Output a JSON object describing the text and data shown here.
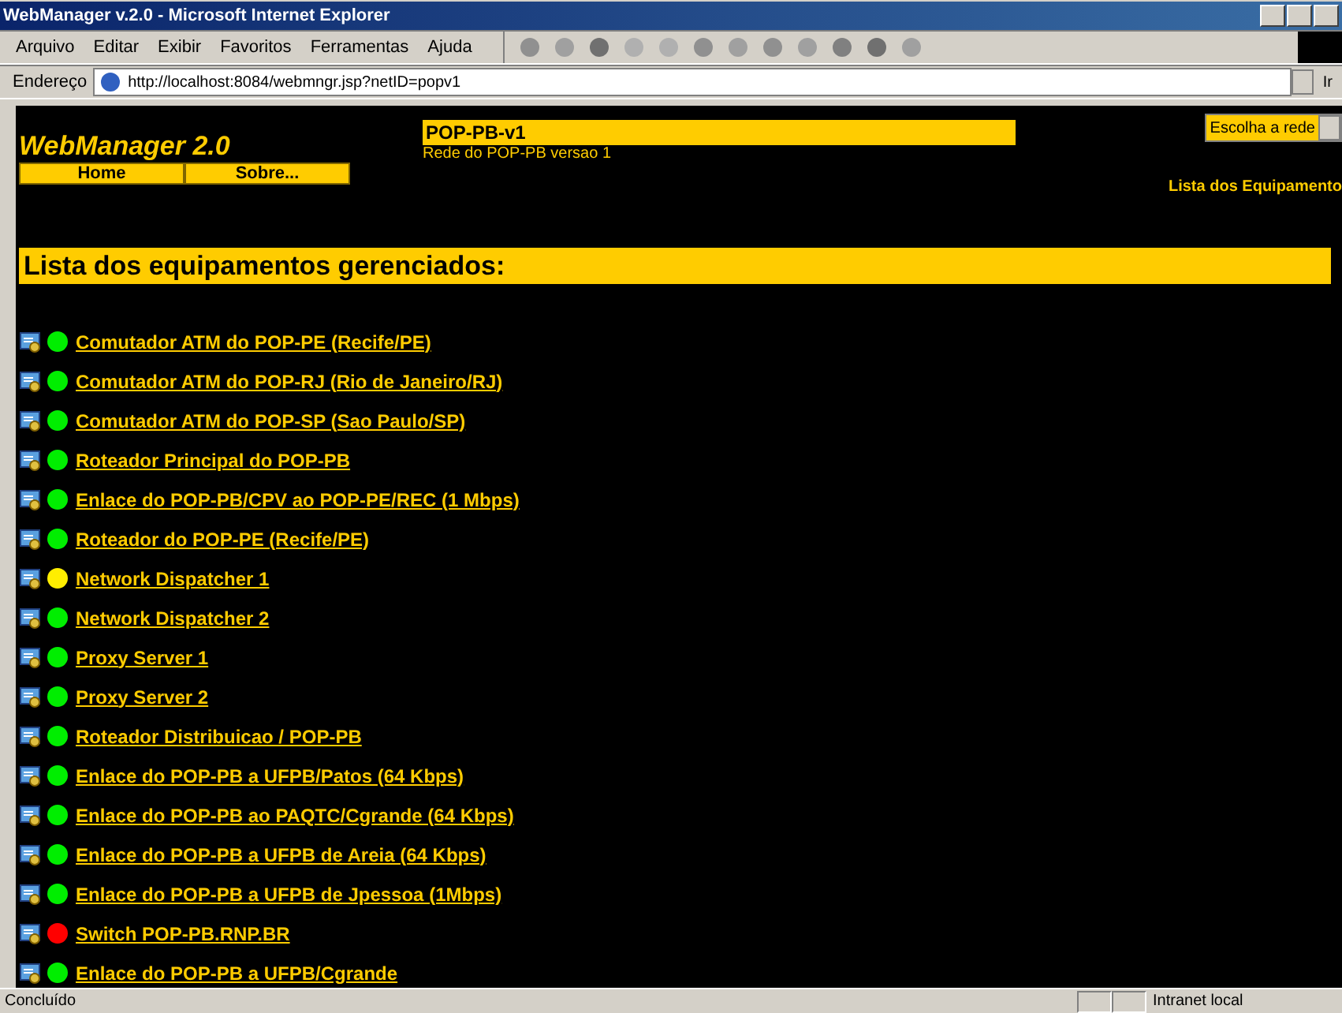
{
  "window": {
    "title": "WebManager v.2.0 - Microsoft Internet Explorer"
  },
  "menu": [
    "Arquivo",
    "Editar",
    "Exibir",
    "Favoritos",
    "Ferramentas",
    "Ajuda"
  ],
  "address": {
    "label": "Endereço",
    "value": "http://localhost:8084/webmngr.jsp?netID=popv1",
    "go": "Ir"
  },
  "page": {
    "logo": "WebManager 2.0",
    "nav": [
      "Home",
      "Sobre..."
    ],
    "network": {
      "name": "POP-PB-v1",
      "description": "Rede do POP-PB versao 1"
    },
    "network_select": "Escolha a rede",
    "side_link": "Lista dos Equipamento",
    "heading": "Lista dos equipamentos gerenciados:",
    "devices": [
      {
        "name": "Comutador ATM do POP-PE (Recife/PE)",
        "color": "#00ee00"
      },
      {
        "name": "Comutador ATM do POP-RJ (Rio de Janeiro/RJ)",
        "color": "#00ee00"
      },
      {
        "name": "Comutador ATM do POP-SP (Sao Paulo/SP)",
        "color": "#00ee00"
      },
      {
        "name": "Roteador Principal do POP-PB",
        "color": "#00ee00"
      },
      {
        "name": "Enlace do POP-PB/CPV ao POP-PE/REC (1 Mbps)",
        "color": "#00ee00"
      },
      {
        "name": "Roteador do POP-PE (Recife/PE)",
        "color": "#00ee00"
      },
      {
        "name": "Network Dispatcher 1",
        "color": "#ffee00"
      },
      {
        "name": "Network Dispatcher 2",
        "color": "#00ee00"
      },
      {
        "name": "Proxy Server 1",
        "color": "#00ee00"
      },
      {
        "name": "Proxy Server 2",
        "color": "#00ee00"
      },
      {
        "name": "Roteador Distribuicao / POP-PB",
        "color": "#00ee00"
      },
      {
        "name": "Enlace do POP-PB a UFPB/Patos (64 Kbps)",
        "color": "#00ee00"
      },
      {
        "name": "Enlace do POP-PB ao PAQTC/Cgrande (64 Kbps)",
        "color": "#00ee00"
      },
      {
        "name": "Enlace do POP-PB a UFPB de Areia (64 Kbps)",
        "color": "#00ee00"
      },
      {
        "name": "Enlace do POP-PB a UFPB de Jpessoa (1Mbps)",
        "color": "#00ee00"
      },
      {
        "name": "Switch POP-PB.RNP.BR",
        "color": "#ff0000"
      },
      {
        "name": "Enlace do POP-PB a UFPB/Cgrande",
        "color": "#00ee00"
      }
    ]
  },
  "status_bar": {
    "text": "Concluído",
    "zone": "Intranet local"
  }
}
